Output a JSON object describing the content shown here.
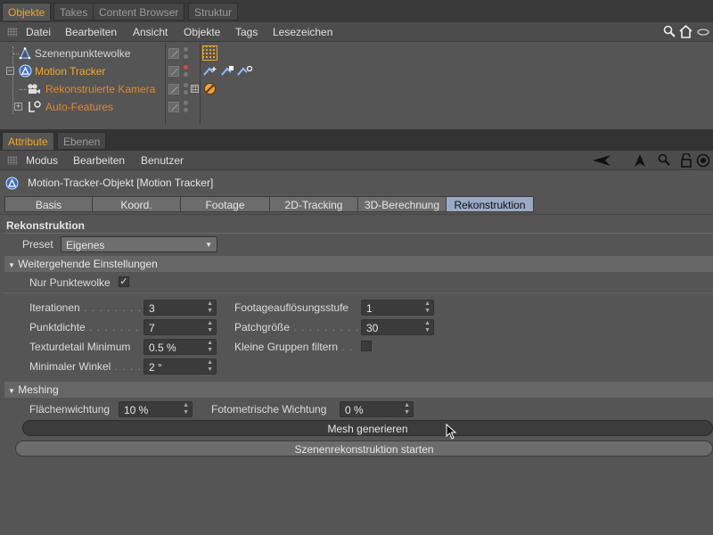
{
  "top_tabs": [
    "Objekte",
    "Takes",
    "Content Browser",
    "Struktur"
  ],
  "object_menu": [
    "Datei",
    "Bearbeiten",
    "Ansicht",
    "Objekte",
    "Tags",
    "Lesezeichen"
  ],
  "objects": [
    {
      "name": "Szenenpunktewolke",
      "icon": "point-cloud-icon",
      "color": "#d6d6d6"
    },
    {
      "name": "Motion Tracker",
      "icon": "motion-tracker-icon",
      "color": "#f5a623"
    },
    {
      "name": "Rekonstruierte Kamera",
      "icon": "camera-icon",
      "color": "#e08a2a"
    },
    {
      "name": "Auto-Features",
      "icon": "null-object-icon",
      "color": "#e08a2a"
    }
  ],
  "attr_tabs": [
    "Attribute",
    "Ebenen"
  ],
  "attr_menu": [
    "Modus",
    "Bearbeiten",
    "Benutzer"
  ],
  "object_header": "Motion-Tracker-Objekt [Motion Tracker]",
  "attr_subtabs": [
    "Basis",
    "Koord.",
    "Footage",
    "2D-Tracking",
    "3D-Berechnung",
    "Rekonstruktion"
  ],
  "active_subtab": "Rekonstruktion",
  "section_title": "Rekonstruktion",
  "preset": {
    "label": "Preset",
    "value": "Eigenes"
  },
  "advanced": {
    "title": "Weitergehende Einstellungen",
    "only_point_cloud": {
      "label": "Nur Punktewolke",
      "checked": "✓"
    },
    "iterations": {
      "label": "Iterationen",
      "dots": " . . . . . . . . . .",
      "value": "3"
    },
    "point_density": {
      "label": "Punktdichte",
      "dots": " . . . . . . . . . .",
      "value": "7"
    },
    "texture_detail": {
      "label": "Texturdetail Minimum",
      "value": "0.5 %"
    },
    "min_angle": {
      "label": "Minimaler Winkel",
      "dots": " . . . .",
      "value": "2 °"
    },
    "footage_level": {
      "label": "Footageauflösungsstufe",
      "value": "1"
    },
    "patch_size": {
      "label": "Patchgröße",
      "dots": " . . . . . . . . . . .",
      "value": "30"
    },
    "filter_groups": {
      "label": "Kleine Gruppen filtern",
      "dots": " . ."
    }
  },
  "meshing": {
    "title": "Meshing",
    "area_weight": {
      "label": "Flächenwichtung",
      "value": "10 %"
    },
    "photo_weight": {
      "label": "Fotometrische Wichtung",
      "value": "0 %"
    }
  },
  "buttons": {
    "generate_mesh": "Mesh generieren",
    "start_reconstruction": "Szenenrekonstruktion starten"
  },
  "colors": {
    "accent": "#f5a623",
    "active_tab": "#9aa9c6",
    "panel": "#555555"
  }
}
